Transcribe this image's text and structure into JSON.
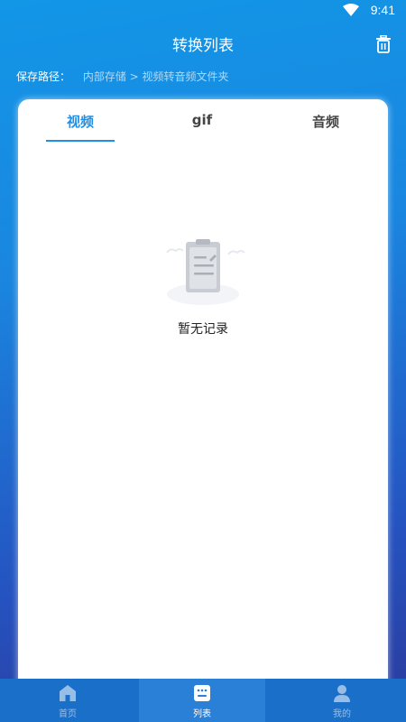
{
  "status_bar": {
    "time": "9:41"
  },
  "header": {
    "title": "转换列表",
    "save_path_label": "保存路径：",
    "save_path_value": "内部存储 > 视频转音频文件夹"
  },
  "tabs": [
    {
      "label": "视频",
      "active": true
    },
    {
      "label": "gif",
      "active": false
    },
    {
      "label": "音频",
      "active": false
    }
  ],
  "empty_state": {
    "message": "暂无记录"
  },
  "bottom_nav": [
    {
      "label": "首页",
      "icon": "home-icon",
      "active": false
    },
    {
      "label": "列表",
      "icon": "list-icon",
      "active": true
    },
    {
      "label": "我的",
      "icon": "profile-icon",
      "active": false
    }
  ],
  "colors": {
    "accent": "#1e90e8",
    "background_top": "#1296e6",
    "background_bottom": "#2c3a9c",
    "nav_background": "#1a6fc8"
  }
}
